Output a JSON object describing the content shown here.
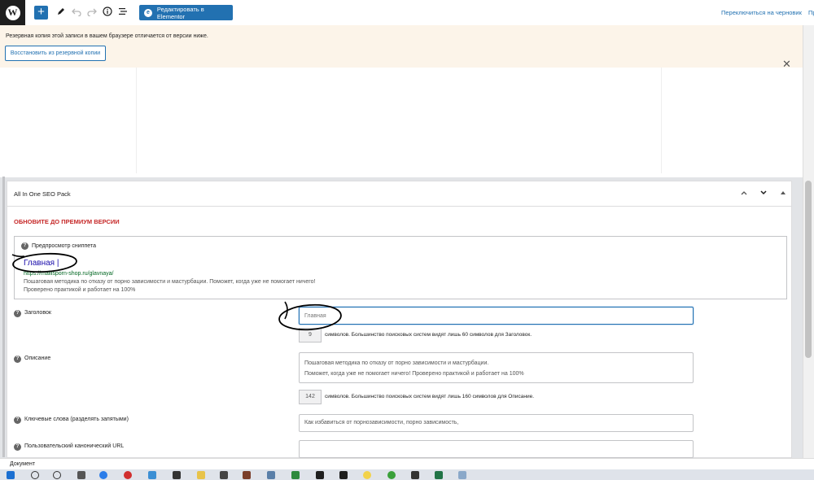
{
  "toolbar": {
    "logo_letter": "W",
    "add_symbol": "+",
    "edit_with_elementor_label": "Редактировать в Elementor",
    "elementor_badge": "e",
    "switch_to_draft_label": "Переключиться на черновик",
    "preview_label_cut": "Пр"
  },
  "notice": {
    "message": "Резервная копия этой записи в вашем браузере отличается от версии ниже.",
    "restore_button_label": "Восстановить из резервной копии",
    "close_symbol": "✕"
  },
  "seo_panel": {
    "title": "All In One SEO Pack",
    "upgrade_text": "ОБНОВИТЕ ДО ПРЕМИУМ ВЕРСИИ",
    "help_symbol": "?",
    "snippet": {
      "label": "Предпросмотр сниппета",
      "title": "Главная |",
      "url": "https://mallisporn-shop.ru/glavnaya/",
      "description": "Пошаговая методика по отказу от порно зависимости и мастурбации. Поможет, когда уже не помогает ничего! Проверено практикой и работает на 100%"
    },
    "fields": {
      "title_label": "Заголовок",
      "title_placeholder": "Главная",
      "title_count": "9",
      "title_count_note": "символов. Большинство поисковых систем видят лишь 60 символов для Заголовок.",
      "description_label": "Описание",
      "description_line1": "Пошаговая методика по отказу от порно зависимости и мастурбации.",
      "description_line2": "Поможет, когда уже не помогает ничего! Проверено практикой и работает на 100%",
      "description_count": "142",
      "description_count_note": "символов. Большинство поисковых систем видят лишь 160 символов для Описание.",
      "keywords_label": "Ключевые слова (разделять запятыми)",
      "keywords_value": "Как избавиться от порнозависимости, порно зависимость,",
      "canonical_label": "Пользовательский канонический URL",
      "canonical_value": ""
    }
  },
  "status_bar": {
    "breadcrumb": "Документ"
  },
  "colors": {
    "accent": "#2271b1",
    "notice_bg": "#fcf4e9",
    "upgrade_red": "#c62828",
    "snippet_link": "#1a0dab",
    "snippet_url": "#006621"
  }
}
